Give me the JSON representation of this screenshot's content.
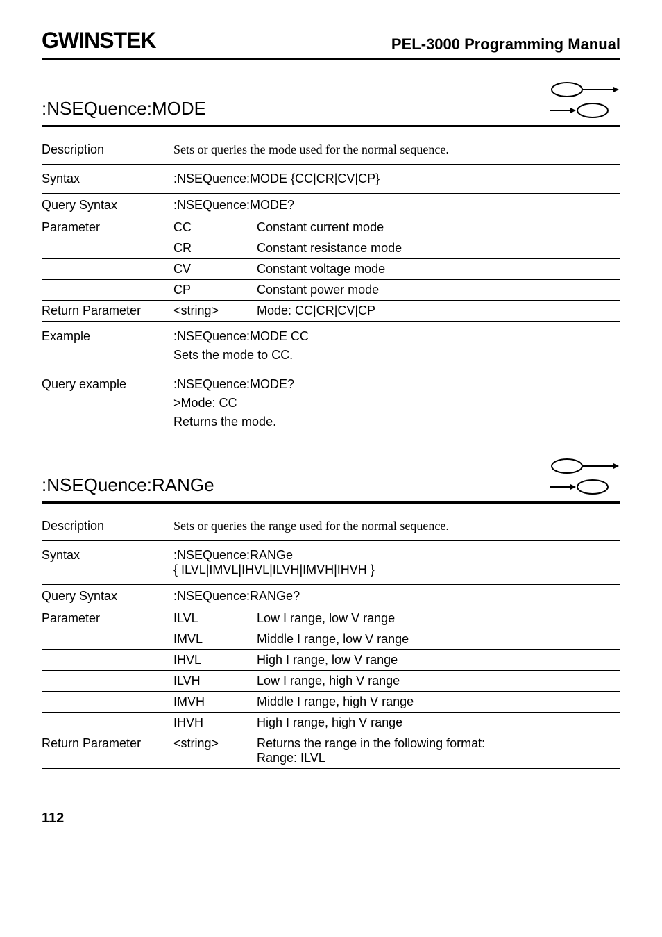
{
  "header": {
    "logo": "GWINSTEK",
    "manual_title": "PEL-3000 Programming Manual"
  },
  "section1": {
    "heading": ":NSEQuence:MODE",
    "description_label": "Description",
    "description": "Sets or queries the mode used for the normal sequence.",
    "syntax_label": "Syntax",
    "syntax": ":NSEQuence:MODE {CC|CR|CV|CP}",
    "query_syntax_label": "Query Syntax",
    "query_syntax": ":NSEQuence:MODE?",
    "parameter_label": "Parameter",
    "params": [
      {
        "code": "CC",
        "desc": "Constant current mode"
      },
      {
        "code": "CR",
        "desc": "Constant resistance mode"
      },
      {
        "code": "CV",
        "desc": "Constant voltage mode"
      },
      {
        "code": "CP",
        "desc": "Constant power mode"
      }
    ],
    "return_param_label": "Return Parameter",
    "return_param_code": "<string>",
    "return_param_desc": "Mode: CC|CR|CV|CP",
    "example_label": "Example",
    "example_cmd": ":NSEQuence:MODE CC",
    "example_desc": "Sets the mode to CC.",
    "query_example_label": "Query example",
    "query_example_cmd": ":NSEQuence:MODE?",
    "query_example_resp": ">Mode: CC",
    "query_example_desc": "Returns the mode."
  },
  "section2": {
    "heading": ":NSEQuence:RANGe",
    "description_label": "Description",
    "description": "Sets or queries the range used for the normal sequence.",
    "syntax_label": "Syntax",
    "syntax_line1": ":NSEQuence:RANGe",
    "syntax_line2": "{ ILVL|IMVL|IHVL|ILVH|IMVH|IHVH }",
    "query_syntax_label": "Query Syntax",
    "query_syntax": ":NSEQuence:RANGe?",
    "parameter_label": "Parameter",
    "params": [
      {
        "code": "ILVL",
        "desc": "Low I range, low V range"
      },
      {
        "code": "IMVL",
        "desc": "Middle I range, low V range"
      },
      {
        "code": "IHVL",
        "desc": "High I range, low V range"
      },
      {
        "code": "ILVH",
        "desc": "Low I range, high V range"
      },
      {
        "code": "IMVH",
        "desc": "Middle I range, high V range"
      },
      {
        "code": "IHVH",
        "desc": "High I range, high V range"
      }
    ],
    "return_param_label": "Return Parameter",
    "return_param_code": "<string>",
    "return_param_desc1": "Returns the range in the following format:",
    "return_param_desc2": "Range: ILVL"
  },
  "page_number": "112"
}
